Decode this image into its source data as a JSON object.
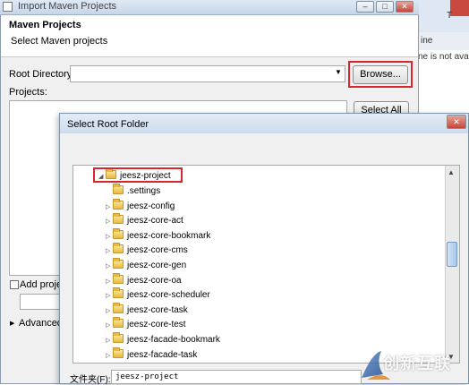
{
  "background_window": {
    "tab_text": "T",
    "tab_text2": "ine",
    "body_text": "ne is not avai"
  },
  "import_dialog": {
    "title": "Import Maven Projects",
    "header_title": "Maven Projects",
    "header_subtitle": "Select Maven projects",
    "root_directory_label": "Root Directory:",
    "root_directory_value": "",
    "browse_label": "Browse...",
    "projects_label": "Projects:",
    "select_all_label": "Select All",
    "add_project_label": "Add proje",
    "advanced_label": "Advanced"
  },
  "select_root_dialog": {
    "title": "Select Root Folder",
    "tree": [
      {
        "label": "jeesz-project",
        "expanded": true,
        "level": 0
      },
      {
        "label": ".settings",
        "level": 1,
        "has_children": false
      },
      {
        "label": "jeesz-config",
        "level": 1,
        "has_children": true
      },
      {
        "label": "jeesz-core-act",
        "level": 1,
        "has_children": true
      },
      {
        "label": "jeesz-core-bookmark",
        "level": 1,
        "has_children": true
      },
      {
        "label": "jeesz-core-cms",
        "level": 1,
        "has_children": true
      },
      {
        "label": "jeesz-core-gen",
        "level": 1,
        "has_children": true
      },
      {
        "label": "jeesz-core-oa",
        "level": 1,
        "has_children": true
      },
      {
        "label": "jeesz-core-scheduler",
        "level": 1,
        "has_children": true
      },
      {
        "label": "jeesz-core-task",
        "level": 1,
        "has_children": true
      },
      {
        "label": "jeesz-core-test",
        "level": 1,
        "has_children": true
      },
      {
        "label": "jeesz-facade-bookmark",
        "level": 1,
        "has_children": true
      },
      {
        "label": "jeesz-facade-task",
        "level": 1,
        "has_children": true
      }
    ],
    "folder_label": "文件夹(F):",
    "folder_value": "jeesz-project"
  },
  "watermark": {
    "text": "创新互联"
  },
  "colors": {
    "highlight": "#d8262c",
    "folder": "#e9b942"
  }
}
